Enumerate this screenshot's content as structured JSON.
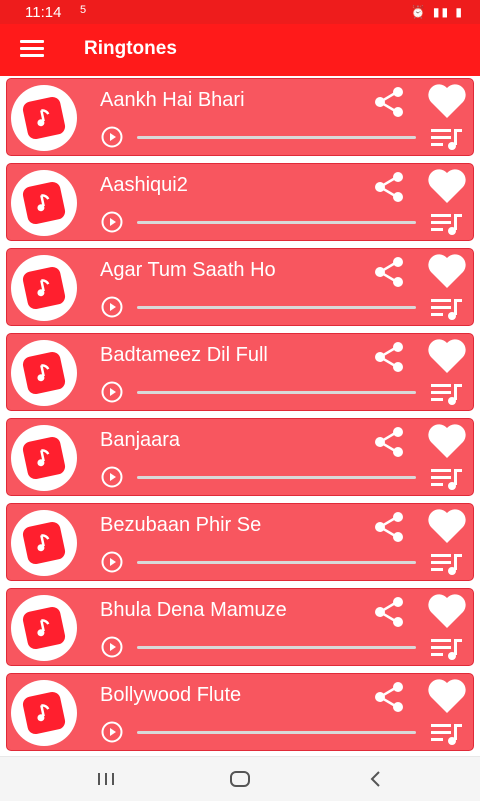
{
  "status_bar": {
    "time": "11:14",
    "extra": "5⁵",
    "icons": "⏰ ▐ ▮"
  },
  "app_bar": {
    "title": "Ringtones"
  },
  "ringtones": [
    {
      "title": "Aankh Hai Bhari",
      "progress": 0
    },
    {
      "title": "Aashiqui2",
      "progress": 0
    },
    {
      "title": "Agar Tum Saath Ho",
      "progress": 0
    },
    {
      "title": "Badtameez Dil Full",
      "progress": 0
    },
    {
      "title": "Banjaara",
      "progress": 0
    },
    {
      "title": "Bezubaan Phir Se",
      "progress": 0
    },
    {
      "title": "Bhula Dena Mamuze",
      "progress": 0
    },
    {
      "title": "Bollywood Flute",
      "progress": 0
    }
  ],
  "icons": {
    "row_avatar": "music-note-icon",
    "play": "play-circle-icon",
    "share": "share-icon",
    "favorite": "heart-icon",
    "playlist": "playlist-music-icon"
  },
  "colors": {
    "status_bar": "#ee1c1c",
    "app_bar": "#ff1a1a",
    "row_background": "#f8565f",
    "note_square": "#ff1f2e"
  }
}
